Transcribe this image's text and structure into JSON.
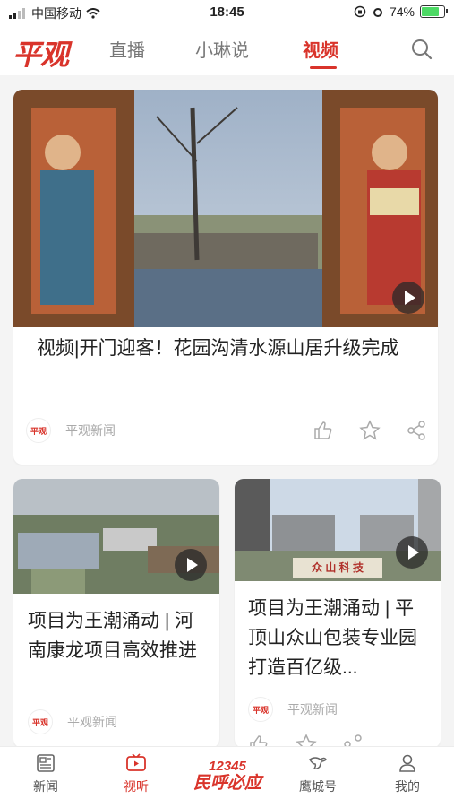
{
  "status_bar": {
    "carrier": "中国移动",
    "time": "18:45",
    "battery": "74%"
  },
  "header": {
    "logo": "平观",
    "tabs": [
      {
        "label": "直播"
      },
      {
        "label": "小琳说"
      },
      {
        "label": "视频",
        "active": true
      }
    ]
  },
  "feed": [
    {
      "title": "视频|开门迎客！花园沟清水源山居升级完成",
      "source": "平观新闻",
      "source_logo": "平观"
    },
    {
      "title": "项目为王潮涌动 | 河南康龙项目高效推进",
      "source": "平观新闻",
      "source_logo": "平观"
    },
    {
      "title": "项目为王潮涌动 | 平顶山众山包装专业园打造百亿级...",
      "source": "平观新闻",
      "source_logo": "平观",
      "image_sign": "众 山 科 技"
    }
  ],
  "tab_bar": {
    "items": [
      {
        "label": "新闻"
      },
      {
        "label": "视听",
        "active": true
      },
      {
        "label": "鹰城号"
      },
      {
        "label": "我的"
      }
    ],
    "hotline": {
      "number": "12345",
      "text": "民呼必应"
    }
  },
  "colors": {
    "accent": "#d9342b"
  }
}
